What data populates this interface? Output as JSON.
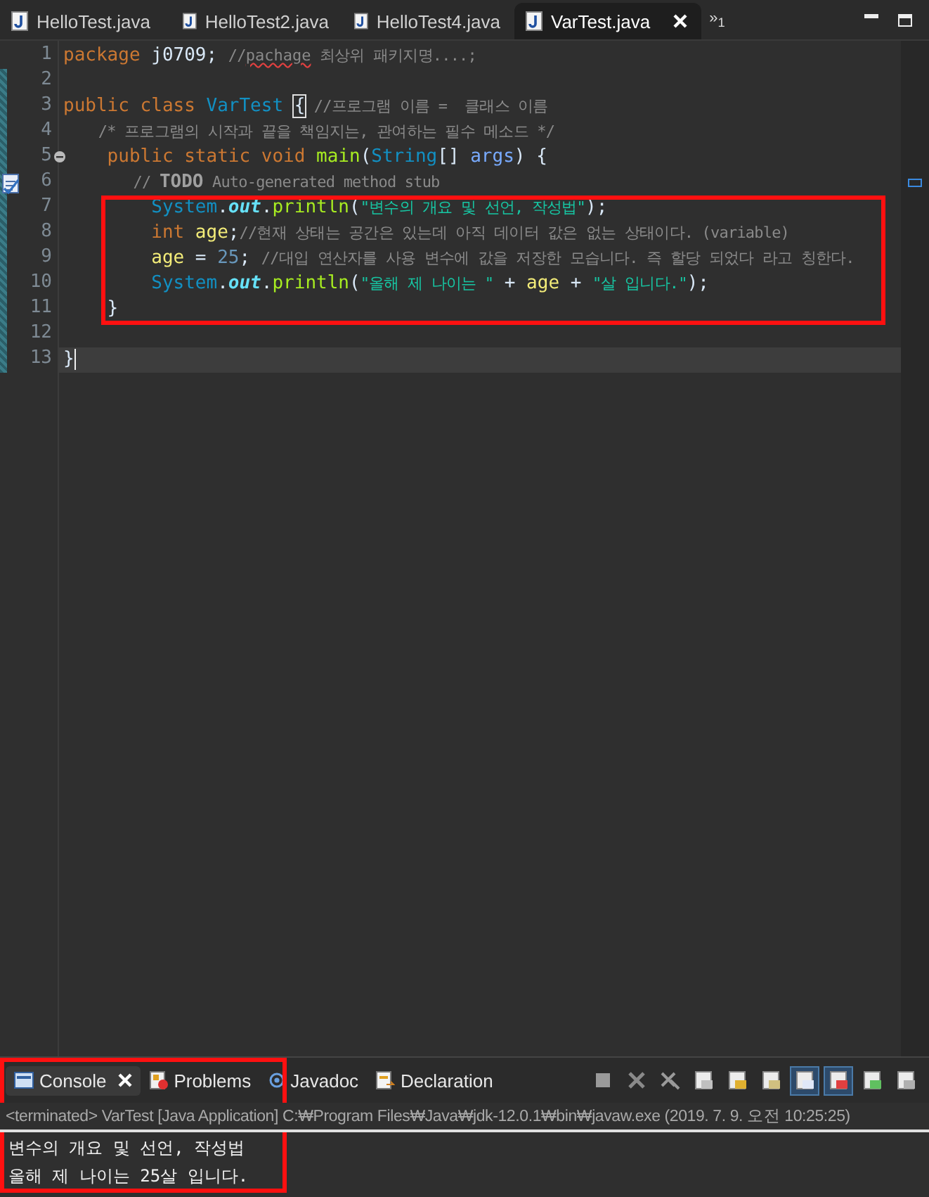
{
  "editor_tabs": [
    {
      "label": "HelloTest.java",
      "selected": false
    },
    {
      "label": "HelloTest2.java",
      "selected": false
    },
    {
      "label": "HelloTest4.java",
      "selected": false
    },
    {
      "label": "VarTest.java",
      "selected": true
    }
  ],
  "tab_overflow": "»$_{1}$",
  "editor": {
    "highlighted": true,
    "lines": [
      {
        "number": "1",
        "kind": "code",
        "current": false,
        "tokens": [
          {
            "kind": "keyword",
            "text": "package"
          },
          {
            "kind": "plain",
            "text": " j0709; "
          },
          {
            "kind": "comment",
            "text": "//"
          },
          {
            "kind": "misspelled",
            "text": "pachage"
          },
          {
            "kind": "comment",
            "text": " 최상위 패키지명....;"
          }
        ]
      },
      {
        "number": "2",
        "kind": "code",
        "current": false
      },
      {
        "number": "3",
        "kind": "code",
        "current": false,
        "tokens": [
          {
            "kind": "keyword",
            "text": "public class "
          },
          {
            "kind": "class",
            "text": "VarTest "
          },
          {
            "kind": "bracket",
            "text": "{"
          },
          {
            "kind": "comment",
            "text": " //프로그램 이름 =  클래스 이름"
          }
        ]
      },
      {
        "number": "4",
        "kind": "code",
        "current": false,
        "tokens": [
          {
            "kind": "comment",
            "text": "    /* 프로그램의 시작과 끝을 책임지는, 관여하는 필수 메소드 */"
          }
        ]
      },
      {
        "number": "5",
        "kind": "fold",
        "current": false,
        "tokens": [
          {
            "kind": "keyword",
            "text": "    public static void "
          },
          {
            "kind": "method",
            "text": "main"
          },
          {
            "kind": "plain",
            "text": "("
          },
          {
            "kind": "class",
            "text": "String"
          },
          {
            "kind": "plain",
            "text": "[] "
          },
          {
            "kind": "param",
            "text": "args"
          },
          {
            "kind": "plain",
            "text": ") {"
          }
        ]
      },
      {
        "number": "6",
        "kind": "task",
        "current": false,
        "tokens": [
          {
            "kind": "comment",
            "text": "        // "
          },
          {
            "kind": "task",
            "text": "TODO"
          },
          {
            "kind": "comment",
            "text": " Auto-generated method stub"
          }
        ]
      },
      {
        "number": "7",
        "kind": "code",
        "current": false,
        "tokens": [
          {
            "kind": "class",
            "text": "        System"
          },
          {
            "kind": "plain",
            "text": "."
          },
          {
            "kind": "field",
            "text": "out"
          },
          {
            "kind": "plain",
            "text": "."
          },
          {
            "kind": "method",
            "text": "println"
          },
          {
            "kind": "plain",
            "text": "("
          },
          {
            "kind": "string",
            "text": "\"변수의 개요 및 선언, 작성법\""
          },
          {
            "kind": "plain",
            "text": ");"
          }
        ]
      },
      {
        "number": "8",
        "kind": "code",
        "current": false,
        "tokens": [
          {
            "kind": "keyword",
            "text": "        int "
          },
          {
            "kind": "variable",
            "text": "age"
          },
          {
            "kind": "plain",
            "text": ";"
          },
          {
            "kind": "comment",
            "text": "//현재 상태는 공간은 있는데 아직 데이터 값은 없는 상태이다. (variable)"
          }
        ]
      },
      {
        "number": "9",
        "kind": "code",
        "current": false,
        "tokens": [
          {
            "kind": "variable",
            "text": "        age"
          },
          {
            "kind": "plain",
            "text": " = "
          },
          {
            "kind": "number",
            "text": "25"
          },
          {
            "kind": "plain",
            "text": "; "
          },
          {
            "kind": "comment",
            "text": "//대입 연산자를 사용 변수에 값을 저장한 모습니다. 즉 할당 되었다 라고 칭한다."
          }
        ]
      },
      {
        "number": "10",
        "kind": "code",
        "current": false,
        "tokens": [
          {
            "kind": "class",
            "text": "        System"
          },
          {
            "kind": "plain",
            "text": "."
          },
          {
            "kind": "field",
            "text": "out"
          },
          {
            "kind": "plain",
            "text": "."
          },
          {
            "kind": "method",
            "text": "println"
          },
          {
            "kind": "plain",
            "text": "("
          },
          {
            "kind": "string",
            "text": "\"올해 제 나이는 \""
          },
          {
            "kind": "plain",
            "text": " + "
          },
          {
            "kind": "variable",
            "text": "age"
          },
          {
            "kind": "plain",
            "text": " + "
          },
          {
            "kind": "string",
            "text": "\"살 입니다.\""
          },
          {
            "kind": "plain",
            "text": ");"
          }
        ]
      },
      {
        "number": "11",
        "kind": "code",
        "current": false,
        "tokens": [
          {
            "kind": "plain",
            "text": "    }"
          }
        ]
      },
      {
        "number": "12",
        "kind": "code",
        "current": false
      },
      {
        "number": "13",
        "kind": "code",
        "current": true,
        "tokens": [
          {
            "kind": "plain",
            "text": "}"
          }
        ]
      }
    ]
  },
  "console": {
    "highlighted": true,
    "tabs": [
      {
        "label": "Console",
        "selected": true
      },
      {
        "label": "Problems",
        "selected": false
      },
      {
        "label": "Javadoc",
        "selected": false
      },
      {
        "label": "Declaration",
        "selected": false
      }
    ],
    "toolbar": [
      {
        "pressed": false
      },
      {
        "pressed": false
      },
      {
        "pressed": false
      },
      {
        "pressed": false
      },
      {
        "pressed": false
      },
      {
        "pressed": false
      },
      {
        "pressed": true
      },
      {
        "pressed": true
      },
      {
        "pressed": false
      },
      {
        "pressed": false
      }
    ],
    "status": "<terminated> VarTest [Java Application] C:₩Program Files₩Java₩jdk-12.0.1₩bin₩javaw.exe (2019. 7. 9. 오전 10:25:25)",
    "output": [
      "변수의 개요 및 선언, 작성법",
      "올해 제 나이는 25살 입니다."
    ]
  }
}
